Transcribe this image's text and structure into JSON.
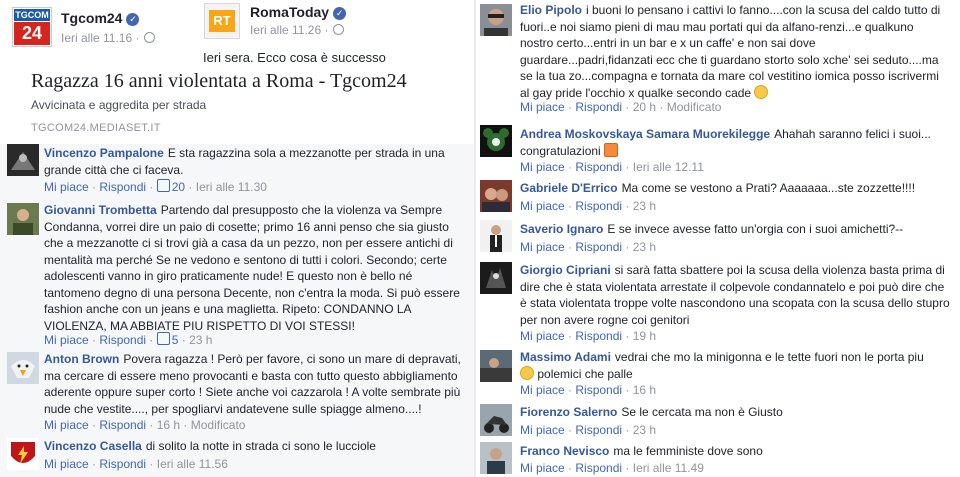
{
  "post": {
    "tgcom_logo_top": "TGCOM",
    "tgcom_logo_num": "24",
    "tgcom_name": "Tgcom24",
    "tgcom_time": "Ieri alle 11.16 ·",
    "roma_logo": "RT",
    "roma_name": "RomaToday",
    "roma_time": "Ieri alle 11.26 ·",
    "text": "Ieri sera. Ecco cosa è successo",
    "link_title": "Ragazza 16 anni violentata a Roma - Tgcom24",
    "link_desc": "Avvicinata e aggredita per strada",
    "link_source": "TGCOM24.MEDIASET.IT"
  },
  "left_comments": [
    {
      "name": "Vincenzo Pampalone",
      "text": "E sta ragazzina sola a mezzanotte per strada in una grande città che ci faceva.",
      "like": "Mi piace",
      "reply": "Rispondi",
      "likes": "20",
      "time": "Ieri alle 11.30",
      "edited": ""
    },
    {
      "name": "Giovanni Trombetta",
      "text": "Partendo dal presupposto che la violenza va Sempre Condanna, vorrei dire un paio di cosette; primo 16 anni penso che sia giusto che a mezzanotte ci si trovi già a casa da un pezzo, non per essere antichi di mentalità ma perché Se ne vedono e sentono di tutti i colori. Secondo; certe adolescenti vanno in giro praticamente nude! E questo non è bello né tantomeno degno di una persona Decente, non c'entra la moda. Si può essere fashion anche con un jeans e una maglietta. Ripeto: CONDANNO LA VIOLENZA, MA ABBIATE PIU RISPETTO DI VOI STESSI!",
      "like": "Mi piace",
      "reply": "Rispondi",
      "likes": "5",
      "time": "23 h",
      "edited": ""
    },
    {
      "name": "Anton Brown",
      "text": "Povera ragazza ! Però per favore, ci sono un mare di depravati, ma cercare di essere meno provocanti e basta con tutto questo abbigliamento aderente oppure super corto ! Siete anche voi cazzarola ! A volte sembrate più nude che vestite...., per spogliarvi andatevene sulle spiagge almeno....!",
      "like": "Mi piace",
      "reply": "Rispondi",
      "likes": "",
      "time": "16 h",
      "edited": "Modificato"
    },
    {
      "name": "Vincenzo Casella",
      "text": "di solito la notte in strada ci sono le lucciole",
      "like": "Mi piace",
      "reply": "Rispondi",
      "likes": "",
      "time": "Ieri alle 11.56",
      "edited": ""
    }
  ],
  "right_comments": [
    {
      "name": "Elio Pipolo",
      "text": "i buoni lo pensano i cattivi lo fanno....con la scusa del caldo tutto di fuori..e noi siamo pieni di mau mau portati qui da alfano-renzi...e qualkuno nostro certo...entri in un bar e x un caffe' e non sai dove guardare...padri,fidanzati ecc che ti guardano storto solo xche' sei seduto....ma se la tua zo...compagna e tornata da mare col vestitino iomica posso iscrivermi al gay pride l'occhio x qualke secondo cade",
      "like": "Mi piace",
      "reply": "Rispondi",
      "time": "20 h",
      "edited": "Modificato"
    },
    {
      "name": "Andrea Moskovskaya Samara Muorekilegge",
      "text": "Ahahah saranno felici i suoi... congratulazioni",
      "like": "Mi piace",
      "reply": "Rispondi",
      "time": "Ieri alle 12.11",
      "edited": ""
    },
    {
      "name": "Gabriele D'Errico",
      "text": "Ma come se vestono a Prati? Aaaaaaa...ste zozzette!!!!",
      "like": "Mi piace",
      "reply": "Rispondi",
      "time": "23 h",
      "edited": ""
    },
    {
      "name": "Saverio Ignaro",
      "text": "E se invece avesse fatto un'orgia con i suoi amichetti?--",
      "like": "Mi piace",
      "reply": "Rispondi",
      "time": "23 h",
      "edited": ""
    },
    {
      "name": "Giorgio Cipriani",
      "text": "si sarà fatta sbattere poi la scusa della violenza basta prima di dire che è stata violentata arrestate il colpevole condannatelo e poi può dire che è stata violentata troppe volte nascondono una scopata con la scusa dello stupro per non avere rogne coi genitori",
      "like": "Mi piace",
      "reply": "Rispondi",
      "time": "19 h",
      "edited": ""
    },
    {
      "name": "Massimo Adami",
      "text": "vedrai che mo la minigonna e le tette fuori non le porta piu",
      "text2": "polemici che palle",
      "like": "Mi piace",
      "reply": "Rispondi",
      "time": "16 h",
      "edited": ""
    },
    {
      "name": "Fiorenzo Salerno",
      "text": "Se le cercata ma non è Giusto",
      "like": "Mi piace",
      "reply": "Rispondi",
      "time": "23 h",
      "edited": ""
    },
    {
      "name": "Franco Nevisco",
      "text": "ma le femministe dove sono",
      "like": "Mi piace",
      "reply": "Rispondi",
      "time": "Ieri alle 11.49",
      "edited": ""
    }
  ],
  "colors": {
    "link": "#365899",
    "action": "#4267b2",
    "meta": "#90949c",
    "bg_comments": "#f6f7f9"
  }
}
